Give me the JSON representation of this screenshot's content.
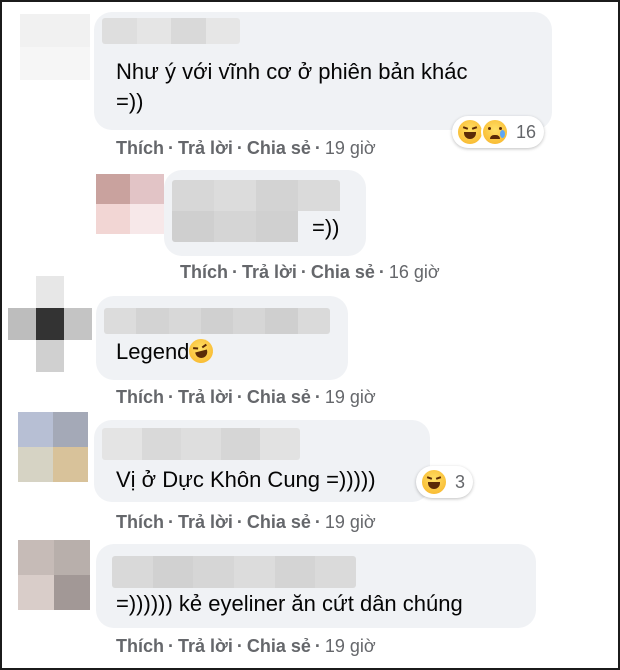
{
  "actions": {
    "like": "Thích",
    "reply": "Trả lời",
    "share": "Chia sẻ",
    "separator": "·"
  },
  "comments": [
    {
      "text_line1": "Như ý với vĩnh cơ ở phiên bản khác",
      "text_line2": "=))",
      "time": "19 giờ",
      "reactions": {
        "types": [
          "haha-icon",
          "sad-icon"
        ],
        "count": "16"
      }
    },
    {
      "text": "=))",
      "time": "16 giờ"
    },
    {
      "text": "Legend",
      "time": "19 giờ",
      "inline_emoji": "rolling-laugh-icon"
    },
    {
      "text": "Vị ở Dực Khôn Cung =)))))",
      "time": "19 giờ",
      "reactions": {
        "types": [
          "haha-icon"
        ],
        "count": "3"
      }
    },
    {
      "text": "=)))))) kẻ eyeliner ăn cứt dân chúng",
      "time": "19 giờ"
    }
  ],
  "colors": {
    "bubble": "#f0f2f5",
    "meta_text": "#65676b",
    "text": "#050505",
    "reaction_yellow": "#f7b125"
  }
}
